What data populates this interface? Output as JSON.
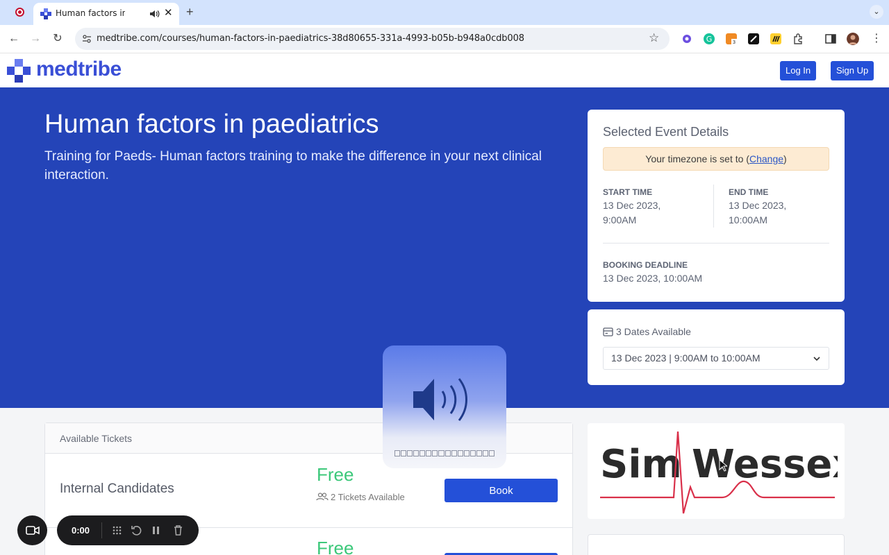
{
  "browser": {
    "tab_title": "Human factors in paediatrics",
    "new_tab_symbol": "+",
    "close_symbol": "✕",
    "url": "medtribe.com/courses/human-factors-in-paediatrics-38d80655-331a-4993-b05b-b948a0cdb008"
  },
  "header": {
    "logo_text": "medtribe",
    "login_label": "Log In",
    "signup_label": "Sign Up"
  },
  "hero": {
    "title": "Human factors in paediatrics",
    "subtitle": "Training for Paeds- Human factors training to make the difference in your next clinical interaction."
  },
  "event": {
    "title": "Selected Event Details",
    "tz_prefix": "Your timezone is set to (",
    "tz_link": "Change",
    "tz_suffix": ")",
    "start_label": "START TIME",
    "start_value": "13 Dec 2023, 9:00AM",
    "end_label": "END TIME",
    "end_value": "13 Dec 2023, 10:00AM",
    "deadline_label": "BOOKING DEADLINE",
    "deadline_value": "13 Dec 2023, 10:00AM"
  },
  "dates": {
    "label": "3 Dates Available",
    "selected": "13 Dec 2023 | 9:00AM to 10:00AM"
  },
  "tickets": {
    "heading": "Available Tickets",
    "items": [
      {
        "name": "Internal Candidates",
        "price": "Free",
        "availability": "2 Tickets Available",
        "button": "Book"
      },
      {
        "name": "",
        "price": "Free",
        "availability": "",
        "button": ""
      }
    ]
  },
  "sponsor": {
    "word_left": "Sim",
    "word_right": "Wessex"
  },
  "recorder": {
    "time": "0:00"
  },
  "colors": {
    "brand_blue": "#2450d8",
    "hero_blue": "#2444b8",
    "free_green": "#3cc87a"
  }
}
